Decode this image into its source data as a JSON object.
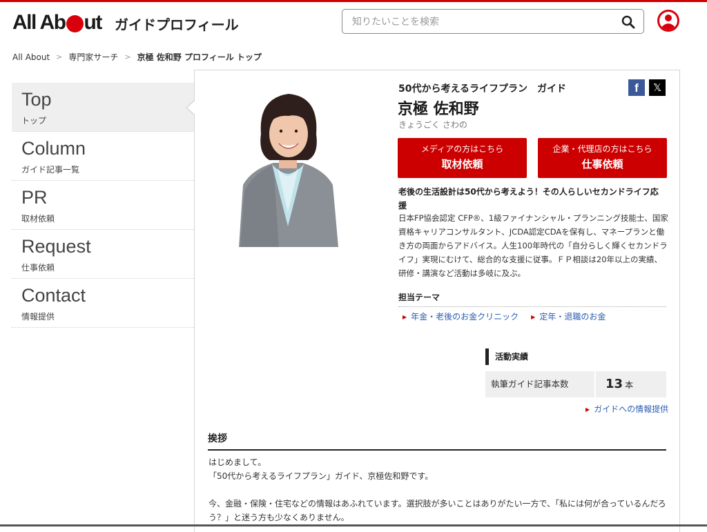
{
  "header": {
    "logo_part1": "All Ab",
    "logo_part2": "ut",
    "site_subtitle": "ガイドプロフィール",
    "search_placeholder": "知りたいことを検索"
  },
  "breadcrumb": {
    "items": [
      "All About",
      "専門家サーチ",
      "京極 佐和野 プロフィール トップ"
    ],
    "separator": ">"
  },
  "sidebar": {
    "items": [
      {
        "en": "Top",
        "ja": "トップ",
        "active": true
      },
      {
        "en": "Column",
        "ja": "ガイド記事一覧"
      },
      {
        "en": "PR",
        "ja": "取材依頼"
      },
      {
        "en": "Request",
        "ja": "仕事依頼"
      },
      {
        "en": "Contact",
        "ja": "情報提供"
      }
    ]
  },
  "profile": {
    "guide_theme": "50代から考えるライフプラン　ガイド",
    "name": "京極 佐和野",
    "reading": "きょうごく さわの",
    "catchphrase": "老後の生活設計は50代から考えよう！その人らしいセカンドライフ応援",
    "bio": "日本FP協会認定 CFP®、1級ファイナンシャル・プランニング技能士、国家資格キャリアコンサルタント、JCDA認定CDAを保有し、マネープランと働き方の両面からアドバイス。人生100年時代の「自分らしく輝くセカンドライフ」実現にむけて、総合的な支援に従事。ＦＰ相談は20年以上の実績、研修・講演など活動は多岐に及ぶ。"
  },
  "share": {
    "facebook": "f",
    "x": "𝕏"
  },
  "requests": [
    {
      "sub": "メディアの方はこちら",
      "main": "取材依頼"
    },
    {
      "sub": "企業・代理店の方はこちら",
      "main": "仕事依頼"
    }
  ],
  "themes": {
    "heading": "担当テーマ",
    "links": [
      "年金・老後のお金クリニック",
      "定年・退職のお金"
    ]
  },
  "activity": {
    "heading": "活動実績",
    "label": "執筆ガイド記事本数",
    "count": "13",
    "unit": "本",
    "info_link": "ガイドへの情報提供"
  },
  "greeting": {
    "heading": "挨拶",
    "lines": [
      "はじめまして。",
      "「50代から考えるライフプラン」ガイド、京極佐和野です。",
      "",
      "今、金融・保険・住宅などの情報はあふれています。選択肢が多いことはありがたい一方で、「私には何が合っているんだろう？」と迷う方も少なくありません。"
    ]
  },
  "colors": {
    "brand_red": "#cc0000",
    "link_blue": "#2a5db0",
    "facebook": "#3b5998"
  }
}
